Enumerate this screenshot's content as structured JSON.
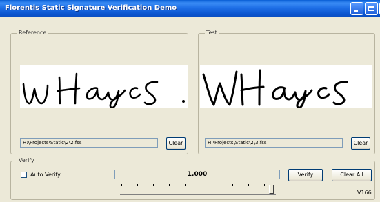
{
  "window": {
    "title": "Florentis Static Signature Verification Demo"
  },
  "reference": {
    "legend": "Reference",
    "path": "H:\\Projects\\Static\\2\\2.fss",
    "clear_label": "Clear",
    "signature_icon": "handwritten-signature"
  },
  "test": {
    "legend": "Test",
    "path": "H:\\Projects\\Static\\2\\3.fss",
    "clear_label": "Clear",
    "signature_icon": "handwritten-signature"
  },
  "verify": {
    "legend": "Verify",
    "auto_verify_label": "Auto Verify",
    "auto_verify_checked": false,
    "score": "1.000",
    "verify_label": "Verify",
    "clear_all_label": "Clear All",
    "version": "V166",
    "slider_level": 1.0
  },
  "colors": {
    "titlebar": "#0b55d0",
    "window_bg": "#ece9d8"
  }
}
